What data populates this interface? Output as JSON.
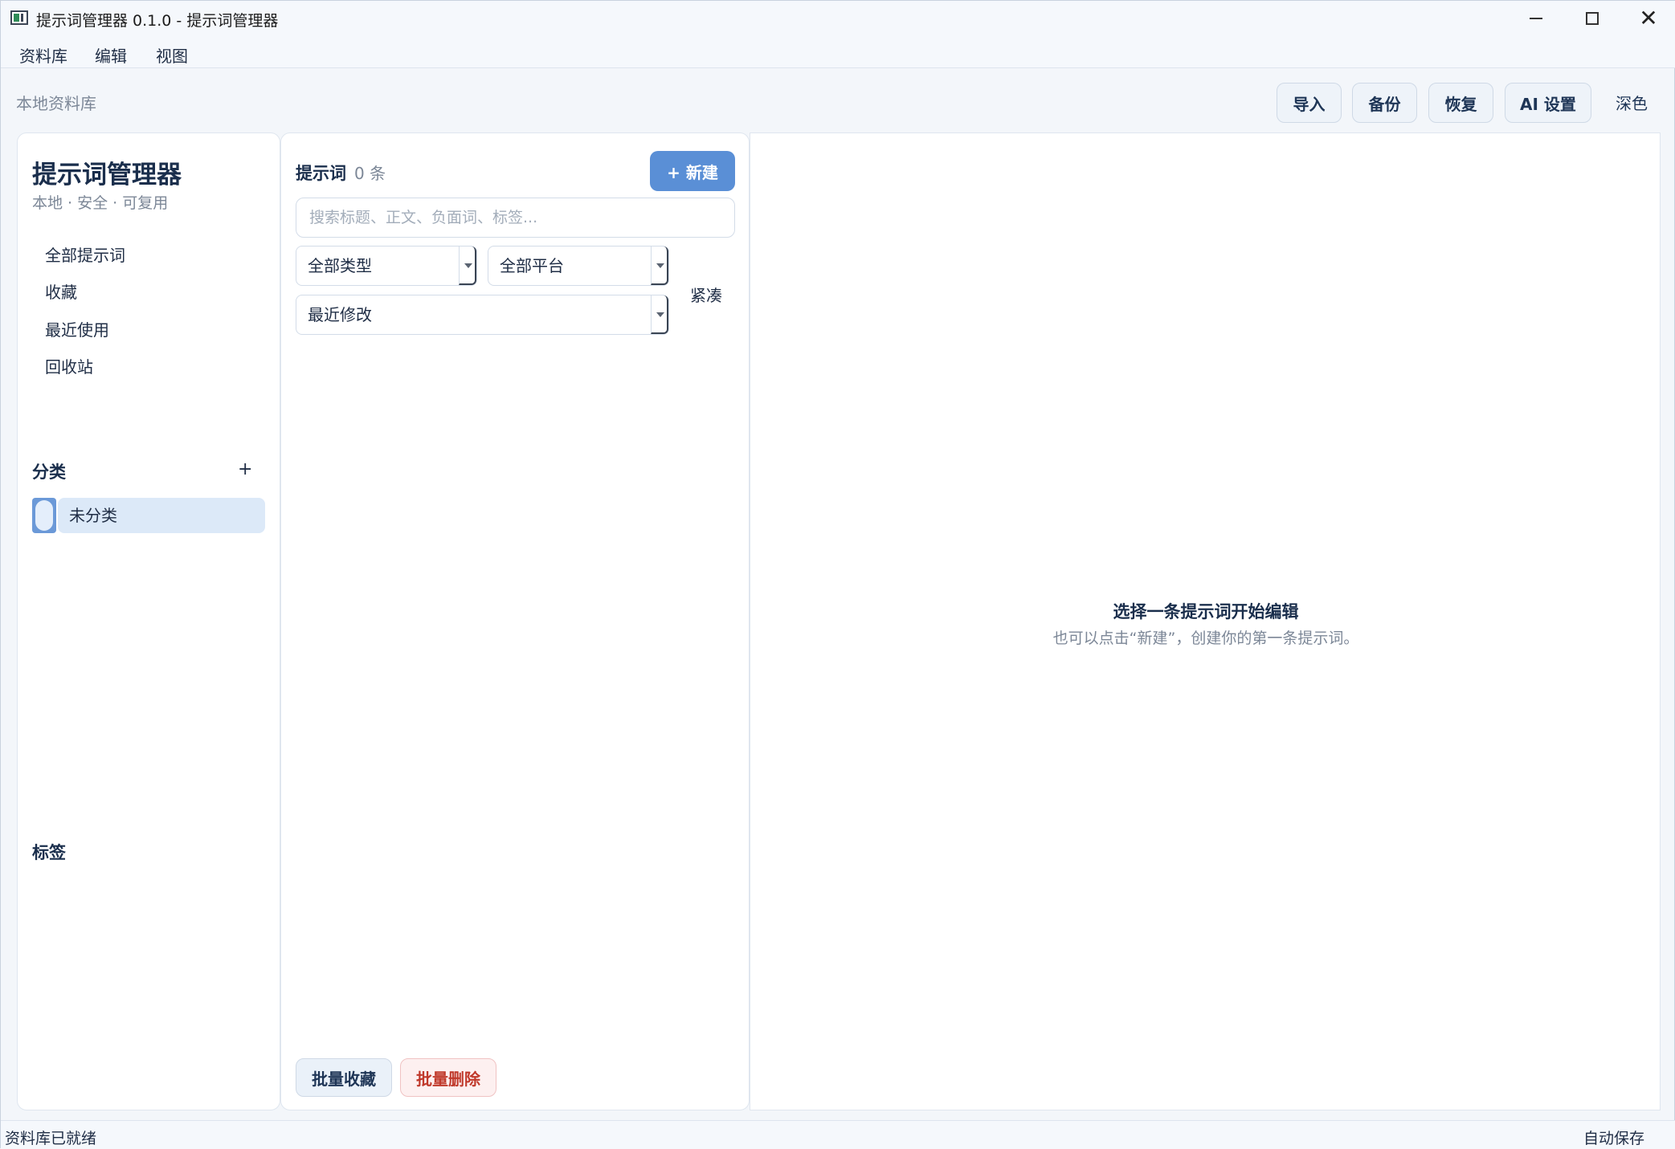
{
  "window": {
    "title": "提示词管理器  0.1.0 - 提示词管理器"
  },
  "menu": {
    "items": [
      "资料库",
      "编辑",
      "视图"
    ]
  },
  "toolbar": {
    "library_label": "本地资料库",
    "import_label": "导入",
    "backup_label": "备份",
    "restore_label": "恢复",
    "ai_settings_label": "AI 设置",
    "theme_label": "深色"
  },
  "sidebar": {
    "brand_title": "提示词管理器",
    "brand_subtitle": "本地 · 安全 · 可复用",
    "nav": [
      "全部提示词",
      "收藏",
      "最近使用",
      "回收站"
    ],
    "categories_title": "分类",
    "add_category": "+",
    "categories": [
      "未分类"
    ],
    "tags_title": "标签"
  },
  "list": {
    "title": "提示词",
    "count": "0 条",
    "new_label": "+ 新建",
    "search_placeholder": "搜索标题、正文、负面词、标签...",
    "type_filter": "全部类型",
    "platform_filter": "全部平台",
    "sort": "最近修改",
    "compact_label": "紧凑",
    "batch_favorite": "批量收藏",
    "batch_delete": "批量删除"
  },
  "editor": {
    "empty_title": "选择一条提示词开始编辑",
    "empty_subtitle": "也可以点击“新建”，创建你的第一条提示词。"
  },
  "status": {
    "left": "资料库已就绪",
    "right": "自动保存"
  },
  "colors": {
    "accent": "#5a8fd6",
    "danger": "#c0392b",
    "selected_bg": "#dce9f8"
  }
}
